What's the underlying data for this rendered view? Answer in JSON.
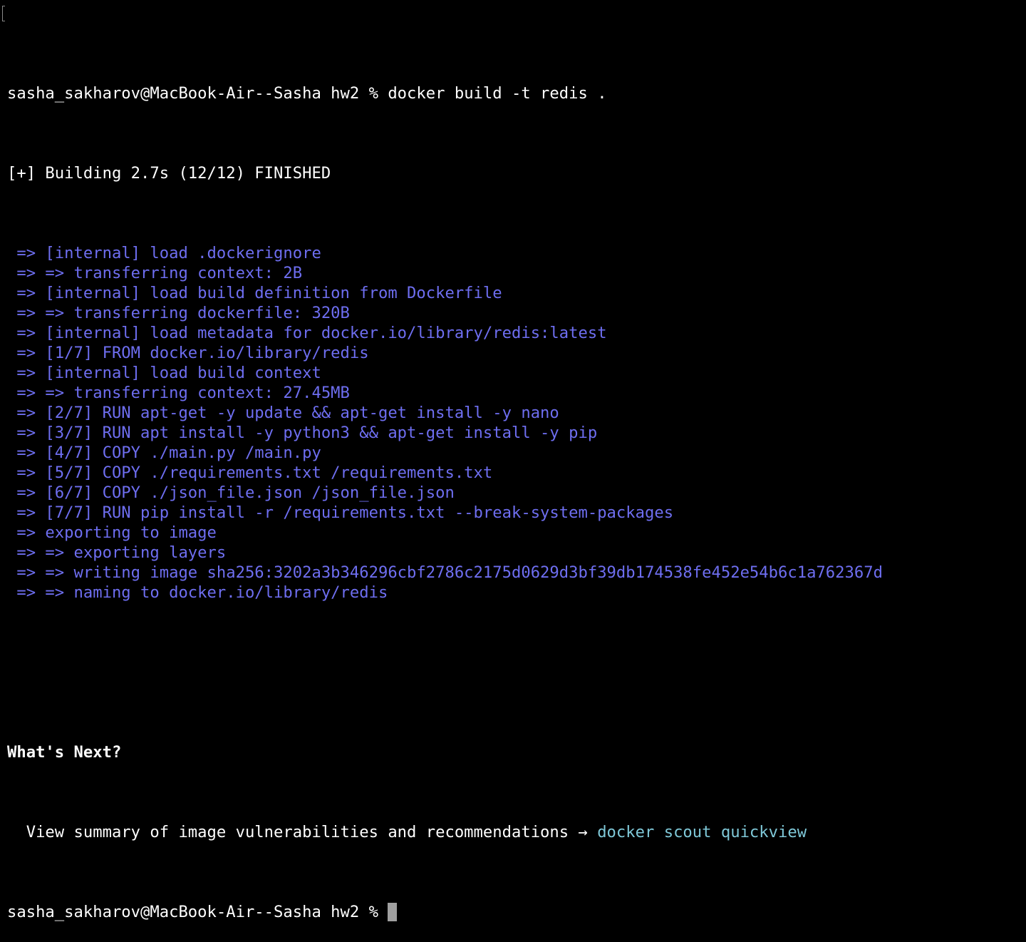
{
  "colors": {
    "background": "#000000",
    "text": "#ffffff",
    "build_step": "#6e6ef0",
    "command_hint": "#7fc8d8",
    "cursor": "#a0a0a0"
  },
  "terminal": {
    "prompt": "sasha_sakharov@MacBook-Air--Sasha hw2 % ",
    "command": "docker build -t redis .",
    "status_line": "[+] Building 2.7s (12/12) FINISHED",
    "build_steps": [
      " => [internal] load .dockerignore",
      " => => transferring context: 2B",
      " => [internal] load build definition from Dockerfile",
      " => => transferring dockerfile: 320B",
      " => [internal] load metadata for docker.io/library/redis:latest",
      " => [1/7] FROM docker.io/library/redis",
      " => [internal] load build context",
      " => => transferring context: 27.45MB",
      " => [2/7] RUN apt-get -y update && apt-get install -y nano",
      " => [3/7] RUN apt install -y python3 && apt-get install -y pip",
      " => [4/7] COPY ./main.py /main.py",
      " => [5/7] COPY ./requirements.txt /requirements.txt",
      " => [6/7] COPY ./json_file.json /json_file.json",
      " => [7/7] RUN pip install -r /requirements.txt --break-system-packages",
      " => exporting to image",
      " => => exporting layers",
      " => => writing image sha256:3202a3b346296cbf2786c2175d0629d3bf39db174538fe452e54b6c1a762367d",
      " => => naming to docker.io/library/redis"
    ],
    "whats_next_heading": "What's Next?",
    "hint_text": "  View summary of image vulnerabilities and recommendations → ",
    "hint_command": "docker scout quickview",
    "final_prompt": "sasha_sakharov@MacBook-Air--Sasha hw2 % "
  }
}
